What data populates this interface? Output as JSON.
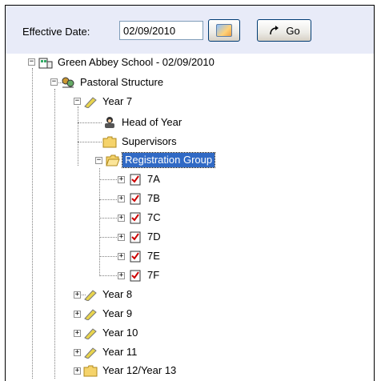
{
  "toolbar": {
    "effective_date_label": "Effective Date:",
    "effective_date_value": "02/09/2010",
    "go_label": "Go"
  },
  "tree": {
    "root": "Green Abbey School - 02/09/2010",
    "pastoral": "Pastoral Structure",
    "year7": "Year  7",
    "head_of_year": "Head of Year",
    "supervisors": "Supervisors",
    "registration_group": "Registration Group",
    "groups": [
      "7A",
      "7B",
      "7C",
      "7D",
      "7E",
      "7F"
    ],
    "year8": "Year  8",
    "year9": "Year  9",
    "year10": "Year 10",
    "year11": "Year 11",
    "year12_13": "Year 12/Year 13"
  },
  "colors": {
    "selection": "#316ac5",
    "toolbar_bg": "#e8ebf8",
    "folder": "#f5d36b"
  }
}
